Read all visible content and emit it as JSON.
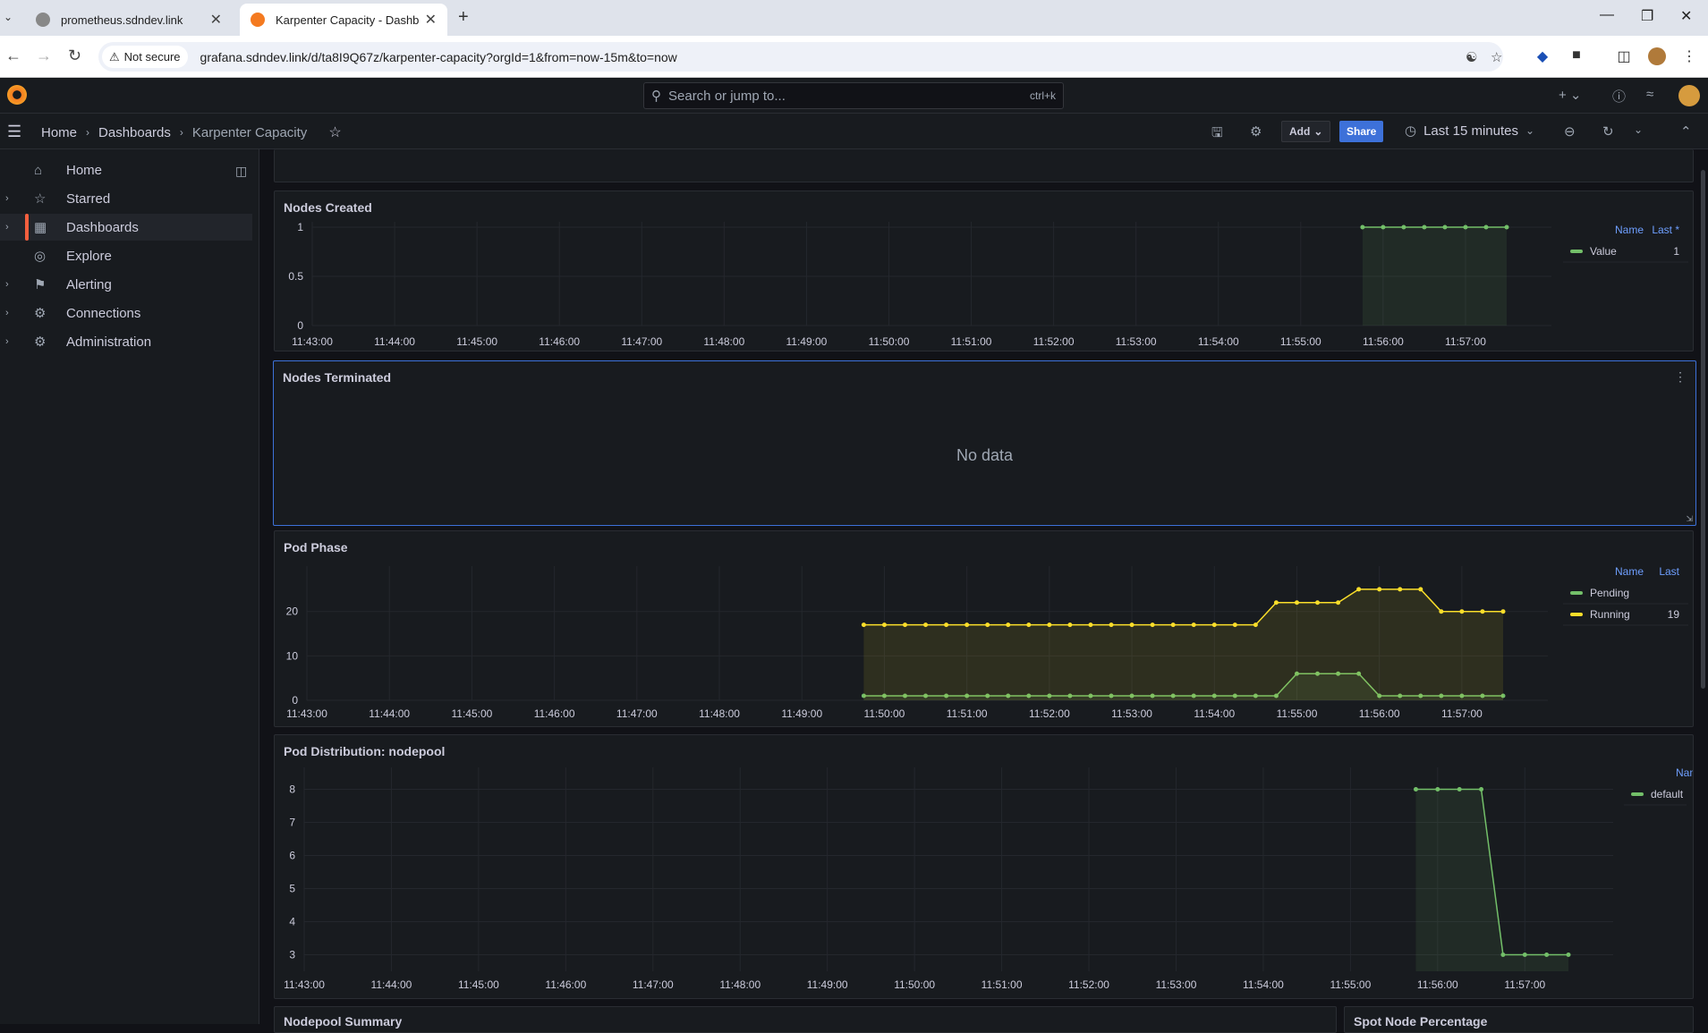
{
  "browser": {
    "tabs": [
      {
        "title": "prometheus.sdndev.link",
        "active": false
      },
      {
        "title": "Karpenter Capacity - Dashboard",
        "active": true
      }
    ],
    "not_secure": "Not secure",
    "url": "grafana.sdndev.link/d/ta8I9Q67z/karpenter-capacity?orgId=1&from=now-15m&to=now"
  },
  "grafana": {
    "search_placeholder": "Search or jump to...",
    "search_shortcut": "ctrl+k",
    "breadcrumbs": [
      "Home",
      "Dashboards",
      "Karpenter Capacity"
    ],
    "add_label": "Add",
    "share_label": "Share",
    "time_range": "Last 15 minutes",
    "sidebar": [
      {
        "label": "Home",
        "icon": "home-icon",
        "expandable": false
      },
      {
        "label": "Starred",
        "icon": "star-icon",
        "expandable": true
      },
      {
        "label": "Dashboards",
        "icon": "dashboards-icon",
        "expandable": true,
        "active": true
      },
      {
        "label": "Explore",
        "icon": "explore-icon",
        "expandable": false
      },
      {
        "label": "Alerting",
        "icon": "bell-icon",
        "expandable": true
      },
      {
        "label": "Connections",
        "icon": "connections-icon",
        "expandable": true
      },
      {
        "label": "Administration",
        "icon": "gear-icon",
        "expandable": true
      }
    ],
    "colors": {
      "green": "#73bf69",
      "yellow": "#fade2a",
      "accent": "#3d71d9"
    }
  },
  "panels": {
    "nodes_terminated": {
      "title": "Nodes Terminated",
      "message": "No data"
    },
    "nodepool_summary": {
      "title": "Nodepool Summary"
    },
    "spot_node_percentage": {
      "title": "Spot Node Percentage"
    }
  },
  "chart_data": [
    {
      "id": "nodes_created",
      "type": "line",
      "title": "Nodes Created",
      "x": [
        "11:43:00",
        "11:44:00",
        "11:45:00",
        "11:46:00",
        "11:47:00",
        "11:48:00",
        "11:49:00",
        "11:50:00",
        "11:51:00",
        "11:52:00",
        "11:53:00",
        "11:54:00",
        "11:55:00",
        "11:56:00",
        "11:57:00"
      ],
      "yticks": [
        "0",
        "0.5",
        "1"
      ],
      "ylim": [
        0,
        1
      ],
      "xlim_minutes": [
        0,
        14.5
      ],
      "legend_headers": [
        "Name",
        "Last *"
      ],
      "series": [
        {
          "name": "Value",
          "color": "#73bf69",
          "last": "1",
          "points": [
            [
              12.75,
              1
            ],
            [
              13.0,
              1
            ],
            [
              13.25,
              1
            ],
            [
              13.5,
              1
            ],
            [
              13.75,
              1
            ],
            [
              14.0,
              1
            ],
            [
              14.25,
              1
            ],
            [
              14.5,
              1
            ]
          ]
        }
      ]
    },
    {
      "id": "pod_phase",
      "type": "line",
      "title": "Pod Phase",
      "x": [
        "11:43:00",
        "11:44:00",
        "11:45:00",
        "11:46:00",
        "11:47:00",
        "11:48:00",
        "11:49:00",
        "11:50:00",
        "11:51:00",
        "11:52:00",
        "11:53:00",
        "11:54:00",
        "11:55:00",
        "11:56:00",
        "11:57:00"
      ],
      "yticks": [
        "0",
        "10",
        "20"
      ],
      "ylim": [
        0,
        29
      ],
      "xlim_minutes": [
        0,
        14.5
      ],
      "legend_headers": [
        "Name",
        "Last"
      ],
      "series": [
        {
          "name": "Pending",
          "color": "#73bf69",
          "last": "",
          "points": [
            [
              6.75,
              1
            ],
            [
              7.0,
              1
            ],
            [
              7.25,
              1
            ],
            [
              7.5,
              1
            ],
            [
              7.75,
              1
            ],
            [
              8.0,
              1
            ],
            [
              8.25,
              1
            ],
            [
              8.5,
              1
            ],
            [
              8.75,
              1
            ],
            [
              9.0,
              1
            ],
            [
              9.25,
              1
            ],
            [
              9.5,
              1
            ],
            [
              9.75,
              1
            ],
            [
              10.0,
              1
            ],
            [
              10.25,
              1
            ],
            [
              10.5,
              1
            ],
            [
              10.75,
              1
            ],
            [
              11.0,
              1
            ],
            [
              11.25,
              1
            ],
            [
              11.5,
              1
            ],
            [
              11.75,
              1
            ],
            [
              12.0,
              6
            ],
            [
              12.25,
              6
            ],
            [
              12.5,
              6
            ],
            [
              12.75,
              6
            ],
            [
              13.0,
              1
            ],
            [
              13.25,
              1
            ],
            [
              13.5,
              1
            ],
            [
              13.75,
              1
            ],
            [
              14.0,
              1
            ],
            [
              14.25,
              1
            ],
            [
              14.5,
              1
            ]
          ]
        },
        {
          "name": "Running",
          "color": "#fade2a",
          "last": "19",
          "points": [
            [
              6.75,
              17
            ],
            [
              7.0,
              17
            ],
            [
              7.25,
              17
            ],
            [
              7.5,
              17
            ],
            [
              7.75,
              17
            ],
            [
              8.0,
              17
            ],
            [
              8.25,
              17
            ],
            [
              8.5,
              17
            ],
            [
              8.75,
              17
            ],
            [
              9.0,
              17
            ],
            [
              9.25,
              17
            ],
            [
              9.5,
              17
            ],
            [
              9.75,
              17
            ],
            [
              10.0,
              17
            ],
            [
              10.25,
              17
            ],
            [
              10.5,
              17
            ],
            [
              10.75,
              17
            ],
            [
              11.0,
              17
            ],
            [
              11.25,
              17
            ],
            [
              11.5,
              17
            ],
            [
              11.75,
              22
            ],
            [
              12.0,
              22
            ],
            [
              12.25,
              22
            ],
            [
              12.5,
              22
            ],
            [
              12.75,
              25
            ],
            [
              13.0,
              25
            ],
            [
              13.25,
              25
            ],
            [
              13.5,
              25
            ],
            [
              13.75,
              20
            ],
            [
              14.0,
              20
            ],
            [
              14.25,
              20
            ],
            [
              14.5,
              20
            ]
          ]
        }
      ]
    },
    {
      "id": "pod_distribution",
      "type": "line",
      "title": "Pod Distribution: nodepool",
      "x": [
        "11:43:00",
        "11:44:00",
        "11:45:00",
        "11:46:00",
        "11:47:00",
        "11:48:00",
        "11:49:00",
        "11:50:00",
        "11:51:00",
        "11:52:00",
        "11:53:00",
        "11:54:00",
        "11:55:00",
        "11:56:00",
        "11:57:00"
      ],
      "yticks": [
        "3",
        "4",
        "5",
        "6",
        "7",
        "8"
      ],
      "ylim": [
        2.5,
        8.5
      ],
      "xlim_minutes": [
        0,
        14.5
      ],
      "legend_headers": [
        "Name"
      ],
      "series": [
        {
          "name": "default",
          "color": "#73bf69",
          "last": "",
          "points": [
            [
              12.75,
              8
            ],
            [
              13.0,
              8
            ],
            [
              13.25,
              8
            ],
            [
              13.5,
              8
            ],
            [
              13.75,
              3
            ],
            [
              14.0,
              3
            ],
            [
              14.25,
              3
            ],
            [
              14.5,
              3
            ]
          ]
        }
      ]
    }
  ]
}
